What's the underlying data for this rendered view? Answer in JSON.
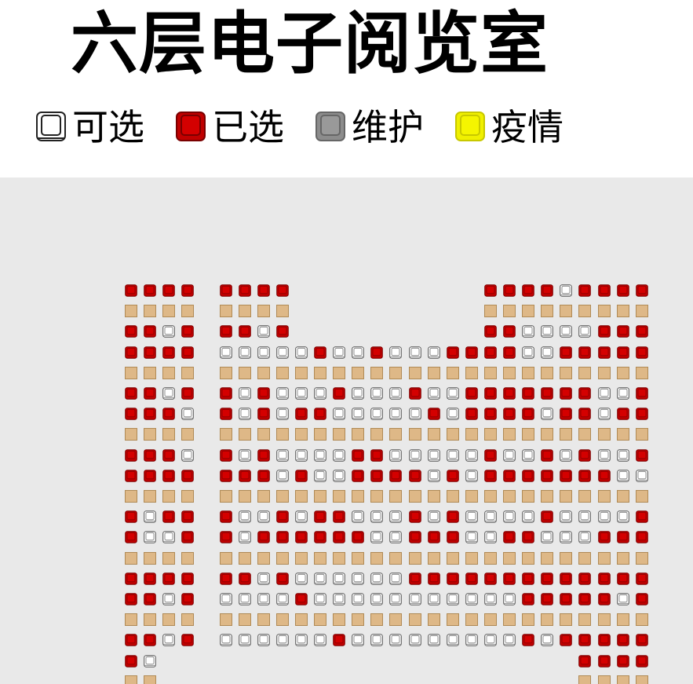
{
  "title": "六层电子阅览室",
  "legend": [
    {
      "label": "可选",
      "status": "available"
    },
    {
      "label": "已选",
      "status": "selected"
    },
    {
      "label": "维护",
      "status": "maintenance"
    },
    {
      "label": "疫情",
      "status": "epidemic"
    }
  ],
  "colors": {
    "available": "#ffffff",
    "selected": "#c00000",
    "maintenance": "#8c8c8c",
    "epidemic": "#f0f000",
    "table": "#deb887",
    "floor_bg": "#e9e9e9"
  },
  "seat_map": {
    "legend_codes": "A=available, S=selected, T=table, .=empty",
    "rows": [
      "SSSS.SSSS..........SSSSASSSS",
      "TTTT.TTTT..........TTTTTTTTT",
      "SSAS.SSAS..........SSAAAASSS",
      "SSSS.AAAAASAASAAASSSSAASSSSS",
      "TTTT.TTTTTTTTTTTTTTTTTTTTTTT",
      "SSAS.SASAAASAAASAASSSSSSSAAS",
      "SSSA.SASASSAAAAASASSSSASSASS",
      "TTTT.TTTTTTTTTTTTTTTTTTTTTTT",
      "SSSA.SASAAAASSAAAAASAASASAAS",
      "SSSS.SSSASAASSSSASASSSSSSSAA",
      "TTTT.TTTTTTTTTTTTTTTTTTTTTTT",
      "SASS.SAASASSAAASASAAAASAAAAS",
      "SAAS.SASSSSSSAASSSAASSAAASSS",
      "TTTT.TTTTTTTTTTTTTTTTTTTTTTT",
      "SSSS.SSASAAAAAASSSSSSSSSSSSS",
      "SSAS.AAAASAAAAAAAAAAASSSSSAS",
      "TTTT.TTTTTTTTTTTTTTTTTTTTTTT",
      "SSAS.AAAAAASAAAAAAAAASASSSSS",
      "SA......................SSSS",
      "TT......................TTTT"
    ]
  }
}
